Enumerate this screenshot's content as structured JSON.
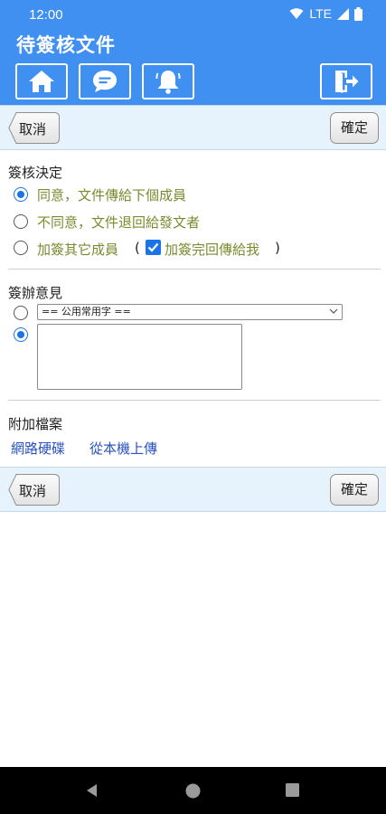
{
  "status_bar": {
    "time": "12:00",
    "network": "LTE",
    "icons": [
      "wifi-icon",
      "signal-icon",
      "battery-icon"
    ]
  },
  "header": {
    "title": "待簽核文件",
    "buttons": [
      "home-icon",
      "chat-icon",
      "bell-icon",
      "logout-icon"
    ]
  },
  "action_bar": {
    "cancel_label": "取消",
    "confirm_label": "確定"
  },
  "decision": {
    "title": "簽核決定",
    "options": [
      {
        "label": "同意，文件傳給下個成員",
        "selected": true
      },
      {
        "label": "不同意，文件退回給發文者",
        "selected": false
      },
      {
        "label": "加簽其它成員",
        "selected": false
      }
    ],
    "paren_open": "(",
    "paren_close": ")",
    "return_checkbox": {
      "label": "加簽完回傳給我",
      "checked": true
    }
  },
  "opinion": {
    "title": "簽辦意見",
    "phrase_select": {
      "selected": "== 公用常用字 ==",
      "radio_selected": false
    },
    "free_text": {
      "value": "",
      "radio_selected": true
    }
  },
  "attachments": {
    "title": "附加檔案",
    "links": [
      "網路硬碟",
      "從本機上傳"
    ]
  },
  "colors": {
    "header_bg": "#3f90f0",
    "action_bar_bg": "#e6f2fc",
    "option_text": "#7a8b2f",
    "link_text": "#2a52be",
    "accent": "#1a73e8"
  }
}
